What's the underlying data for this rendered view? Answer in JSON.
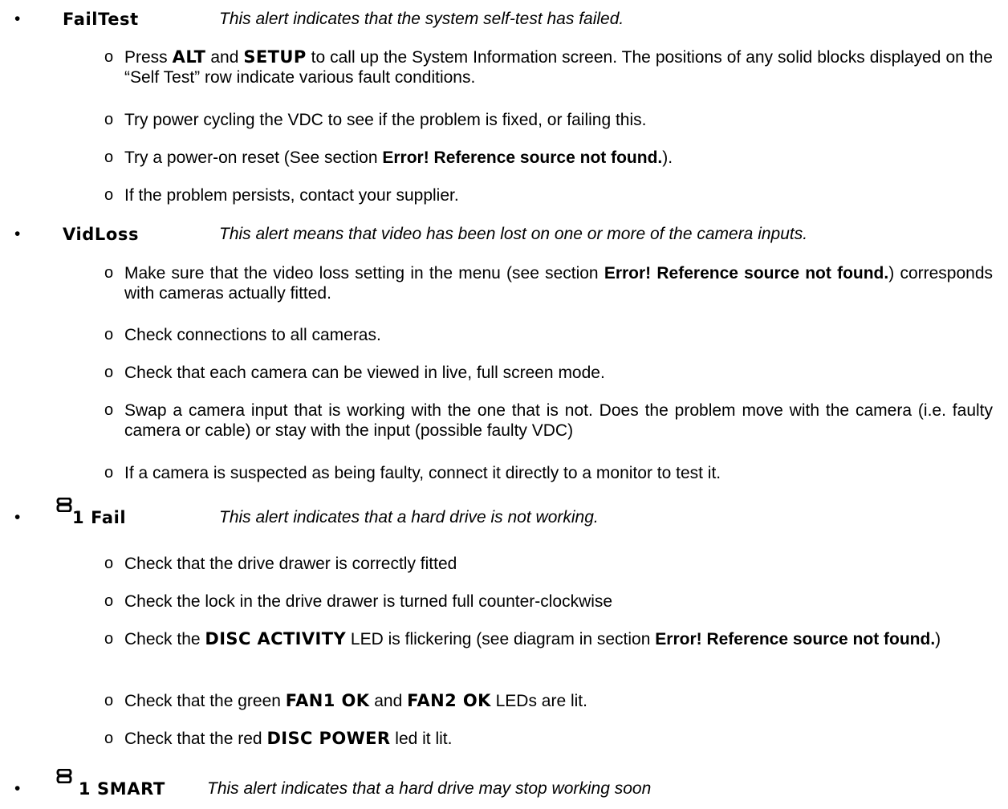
{
  "bullet_symbol": "•",
  "sub_symbol": "o",
  "failtest": {
    "term": "FailTest",
    "desc": "This alert indicates that the system self-test has failed.",
    "items": {
      "i1_a": "Press ",
      "i1_alt": "ALT",
      "i1_b": " and ",
      "i1_setup": "SETUP",
      "i1_c": " to call up the System Information screen. The positions of any solid blocks displayed on the “Self Test” row indicate various fault conditions.",
      "i2": "Try power cycling the VDC to see if the problem is fixed, or failing this.",
      "i3_a": "Try a power-on reset (See section ",
      "i3_err": "Error! Reference source not found.",
      "i3_b": ").",
      "i4": "If the problem persists, contact your supplier."
    }
  },
  "vidloss": {
    "term": "VidLoss",
    "desc": "This alert means that video has been lost on one or more of the camera inputs.",
    "items": {
      "i1_a": "Make sure that the video loss setting in the menu (see section ",
      "i1_err": "Error! Reference source not found.",
      "i1_b": ") corresponds with cameras actually fitted.",
      "i2": "Check connections to all cameras.",
      "i3": "Check that each camera can be viewed in live, full screen mode.",
      "i4": "Swap a camera input that is working with the one that is not. Does the problem move with the camera (i.e. faulty camera or cable) or stay with the input (possible faulty VDC)",
      "i5": "If a camera is suspected as being faulty, connect it directly to a monitor to test it."
    }
  },
  "fail1": {
    "icon": "disc-icon",
    "term": "1 Fail",
    "desc": "This alert indicates that a hard drive is not working.",
    "items": {
      "i1": "Check that the drive drawer is correctly fitted",
      "i2": "Check the lock in the drive drawer is turned full counter-clockwise",
      "i3_a": "Check the ",
      "i3_kw": "DISC ACTIVITY",
      "i3_b": " LED is flickering (see diagram in section ",
      "i3_err": "Error! Reference source not found.",
      "i3_c": ")",
      "i4_a": "Check that the green ",
      "i4_kw1": "FAN1 OK",
      "i4_b": " and ",
      "i4_kw2": "FAN2 OK",
      "i4_c": " LEDs are lit.",
      "i5_a": "Check that the red ",
      "i5_kw": "DISC POWER",
      "i5_b": " led it lit."
    }
  },
  "smart1": {
    "icon": "disc-icon",
    "term": "1 SMART",
    "desc": "This alert indicates that a hard drive may stop working soon"
  }
}
